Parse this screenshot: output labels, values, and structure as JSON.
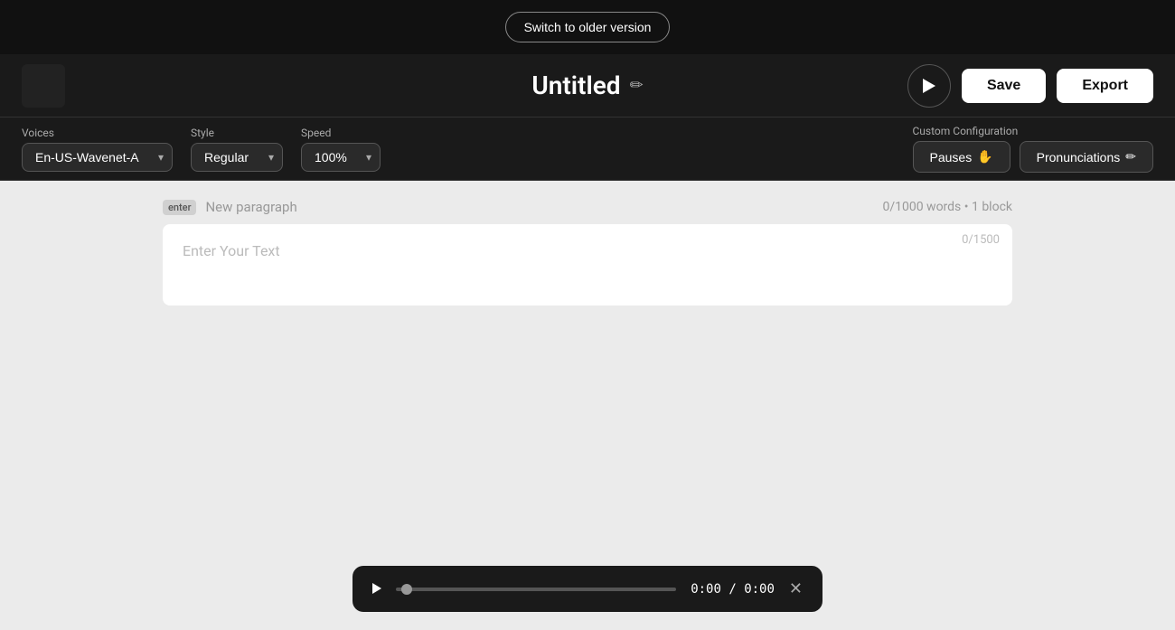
{
  "topBar": {
    "switchBtn": "Switch to older version"
  },
  "header": {
    "title": "Untitled",
    "editIconLabel": "✏",
    "saveBtn": "Save",
    "exportBtn": "Export"
  },
  "toolbar": {
    "voices": {
      "label": "Voices",
      "selected": "En-US-Wavenet-A"
    },
    "style": {
      "label": "Style",
      "selected": "Regular"
    },
    "speed": {
      "label": "Speed",
      "selected": "100%"
    },
    "customConfig": {
      "label": "Custom Configuration",
      "pausesBtn": "Pauses",
      "pausesIcon": "✋",
      "pronunciationsBtn": "Pronunciations",
      "pronunciationsIcon": "✏"
    }
  },
  "content": {
    "enterBadge": "enter",
    "newParagraph": "New paragraph",
    "wordCount": "0/1000 words",
    "blockCount": "1 block",
    "charCount": "0/1500",
    "textPlaceholder": "Enter Your Text"
  },
  "mediaPlayer": {
    "timeDisplay": "0:00 / 0:00"
  }
}
